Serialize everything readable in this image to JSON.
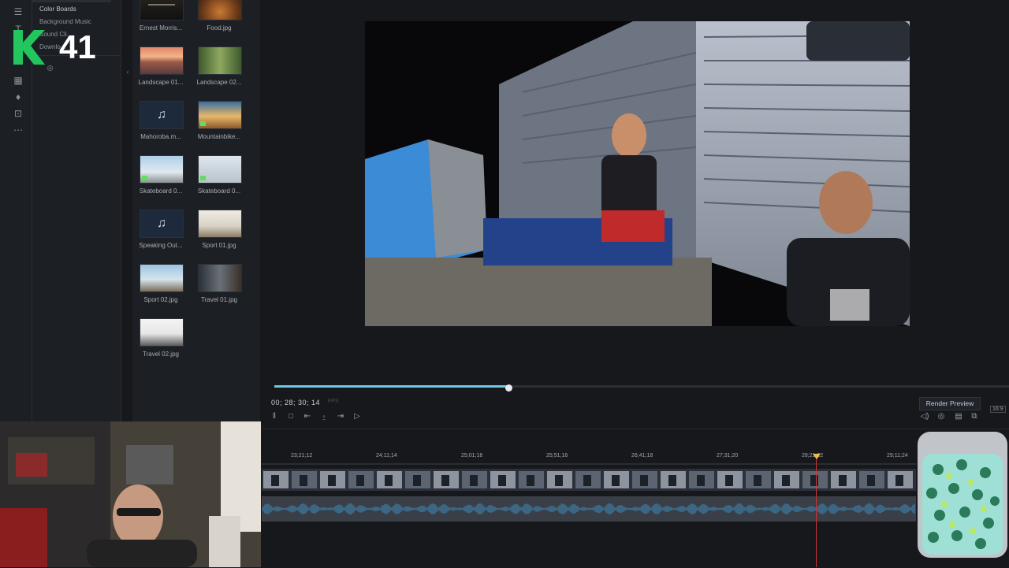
{
  "logo": {
    "letter": "K",
    "number": "41",
    "accent": "#22c55e"
  },
  "categories": {
    "items": [
      {
        "label": "Color Boards",
        "active": true
      },
      {
        "label": "Background Music",
        "active": false
      },
      {
        "label": "Sound Cli...",
        "active": false
      },
      {
        "label": "Downlo...",
        "active": false
      }
    ]
  },
  "media": {
    "items": [
      {
        "label": "Ernest Morris...",
        "kind": "image"
      },
      {
        "label": "Food.jpg",
        "kind": "image"
      },
      {
        "label": "Landscape 01...",
        "kind": "image"
      },
      {
        "label": "Landscape 02...",
        "kind": "image"
      },
      {
        "label": "Mahoroba.m...",
        "kind": "music",
        "icon": "music-note-icon"
      },
      {
        "label": "Mountainbike...",
        "kind": "image"
      },
      {
        "label": "Skateboard 0...",
        "kind": "image"
      },
      {
        "label": "Skateboard 0...",
        "kind": "image"
      },
      {
        "label": "Speaking Out...",
        "kind": "music",
        "icon": "music-note-icon"
      },
      {
        "label": "Sport 01.jpg",
        "kind": "image"
      },
      {
        "label": "Sport 02.jpg",
        "kind": "image"
      },
      {
        "label": "Travel 01.jpg",
        "kind": "image"
      },
      {
        "label": "Travel 02.jpg",
        "kind": "image"
      }
    ]
  },
  "preview": {
    "timecode": "00; 28; 30; 14",
    "fps": "FPS",
    "progress": 0.32,
    "render_label": "Render Preview",
    "aspect": "16:9"
  },
  "timeline": {
    "ticks": [
      "23;21;12",
      "24;11;14",
      "25;01;16",
      "25;51;16",
      "26;41;18",
      "27;31;20",
      "28;21;22",
      "29;11;24"
    ]
  },
  "colors": {
    "accent": "#6fc6e6",
    "playhead": "#d13434",
    "badge_green": "#5ee05e"
  }
}
